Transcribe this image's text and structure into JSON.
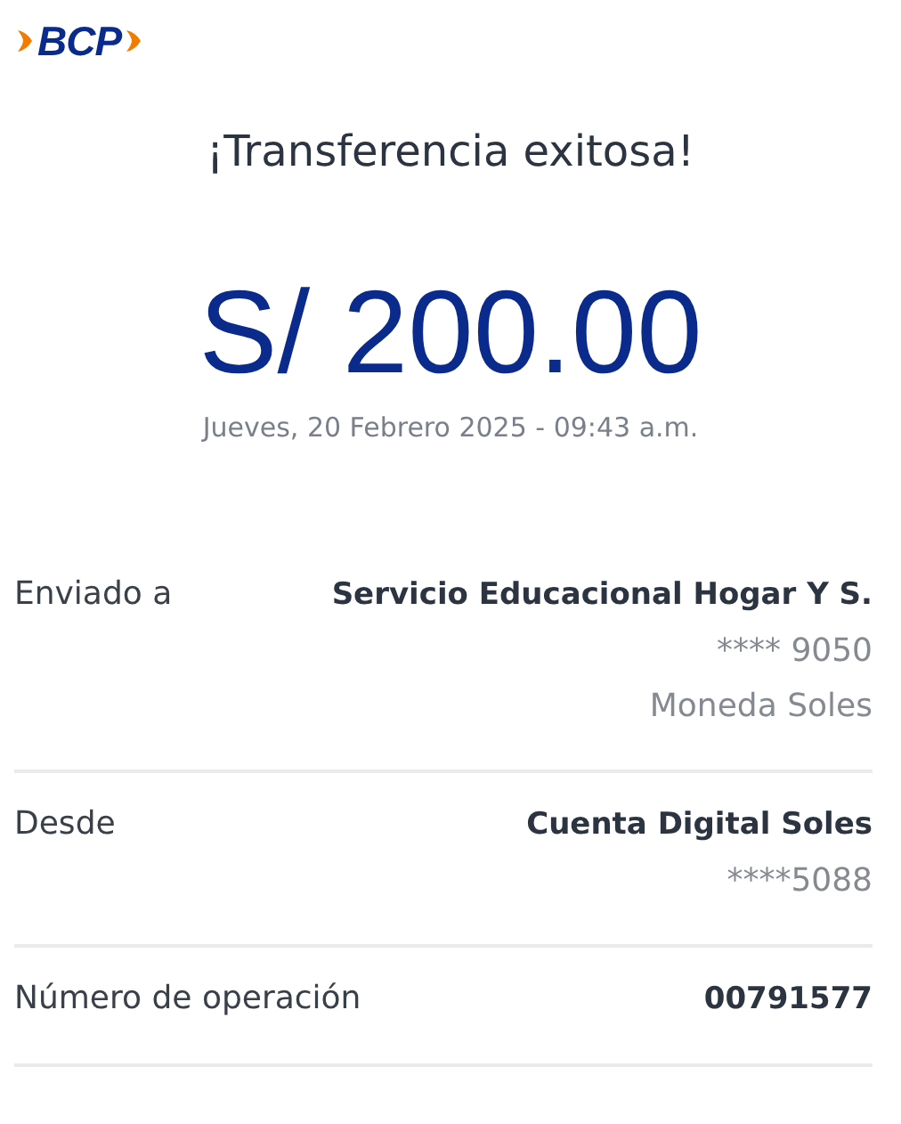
{
  "logo": {
    "text": "BCP"
  },
  "title": "¡Transferencia exitosa!",
  "amount": "S/ 200.00",
  "datetime": "Jueves, 20 Febrero 2025 - 09:43 a.m.",
  "details": [
    {
      "label": "Enviado a",
      "values": [
        {
          "kind": "primary",
          "text": "Servicio Educacional Hogar Y S."
        },
        {
          "kind": "secondary",
          "text": "**** 9050"
        },
        {
          "kind": "secondary",
          "text": "Moneda Soles"
        }
      ]
    },
    {
      "label": "Desde",
      "values": [
        {
          "kind": "primary",
          "text": "Cuenta Digital Soles"
        },
        {
          "kind": "secondary",
          "text": "****5088"
        }
      ]
    },
    {
      "label": "Número de operación",
      "values": [
        {
          "kind": "primary",
          "text": "00791577"
        }
      ]
    }
  ]
}
